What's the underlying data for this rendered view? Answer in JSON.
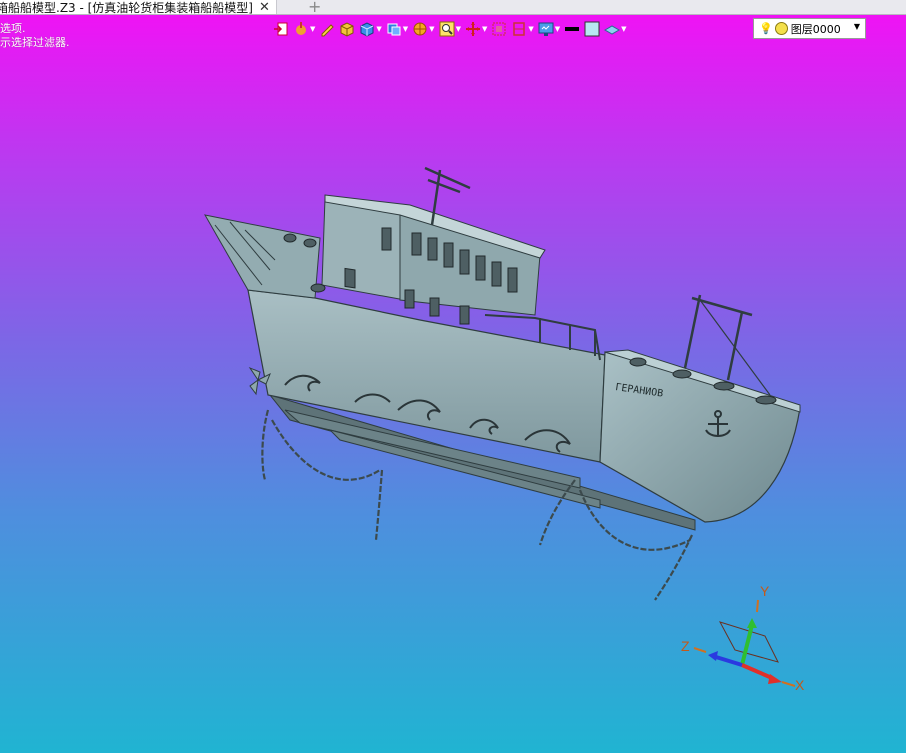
{
  "window": {
    "tab_title": "箱船船模型.Z3 - [仿真油轮货柜集装箱船船模型]",
    "close_symbol": "✕",
    "new_tab_symbol": "+"
  },
  "prompt": {
    "line1": "选项.",
    "line2": "示选择过滤器."
  },
  "toolbar": {
    "items": [
      {
        "icon": "exit-icon"
      },
      {
        "icon": "paint-icon"
      },
      {
        "icon": "pen-icon"
      },
      {
        "icon": "box-icon"
      },
      {
        "icon": "cube-icon"
      },
      {
        "icon": "view-cube-icon"
      },
      {
        "icon": "render-sphere-icon"
      },
      {
        "icon": "zoom-icon"
      },
      {
        "icon": "move-icon"
      },
      {
        "icon": "fit-view-icon"
      },
      {
        "icon": "section-icon"
      },
      {
        "icon": "display-icon"
      },
      {
        "icon": "line-color-icon"
      },
      {
        "icon": "fill-color-icon"
      },
      {
        "icon": "layer-shape-icon"
      }
    ],
    "layer_name": "图层0000"
  },
  "colors": {
    "bg_top": "#f50ff5",
    "bg_bottom": "#20b4d2",
    "hull": "#8fa8ad",
    "hull_dark": "#5e7378",
    "axis_x": "#e0302a",
    "axis_y": "#2fbf2f",
    "axis_z": "#2a3ae0"
  },
  "model": {
    "hull_name": "ГЕРАНИОВ"
  },
  "axes": {
    "x_label": "X",
    "y_label": "Y",
    "z_label": "Z"
  }
}
